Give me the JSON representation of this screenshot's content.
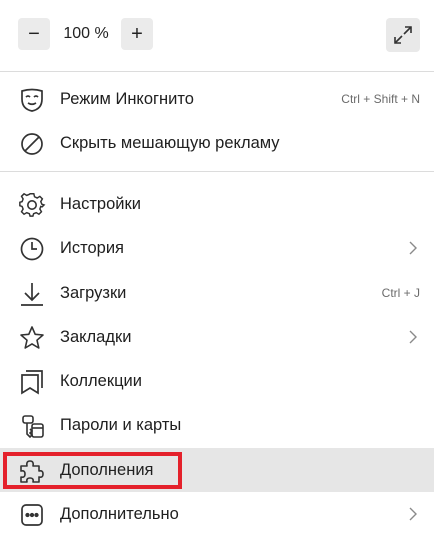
{
  "zoom": {
    "minus_label": "−",
    "value": "100 %",
    "plus_label": "+",
    "fullscreen_icon": "expand-arrows-icon"
  },
  "section1": [
    {
      "label": "Режим Инкогнито",
      "shortcut": "Ctrl + Shift + N",
      "icon": "incognito-mask-icon"
    },
    {
      "label": "Скрыть мешающую рекламу",
      "icon": "block-circle-icon"
    }
  ],
  "section2": [
    {
      "label": "Настройки",
      "icon": "gear-icon"
    },
    {
      "label": "История",
      "icon": "clock-icon",
      "submenu": true
    },
    {
      "label": "Загрузки",
      "shortcut": "Ctrl + J",
      "icon": "download-icon"
    },
    {
      "label": "Закладки",
      "icon": "star-icon",
      "submenu": true
    },
    {
      "label": "Коллекции",
      "icon": "collections-icon"
    },
    {
      "label": "Пароли и карты",
      "icon": "key-card-icon"
    },
    {
      "label": "Дополнения",
      "icon": "puzzle-icon",
      "highlighted": true
    },
    {
      "label": "Дополнительно",
      "icon": "more-dots-icon",
      "submenu": true
    }
  ],
  "colors": {
    "highlight_border": "#e4212b",
    "hover_background": "#e6e6e6",
    "divider": "#dcdcdc"
  }
}
